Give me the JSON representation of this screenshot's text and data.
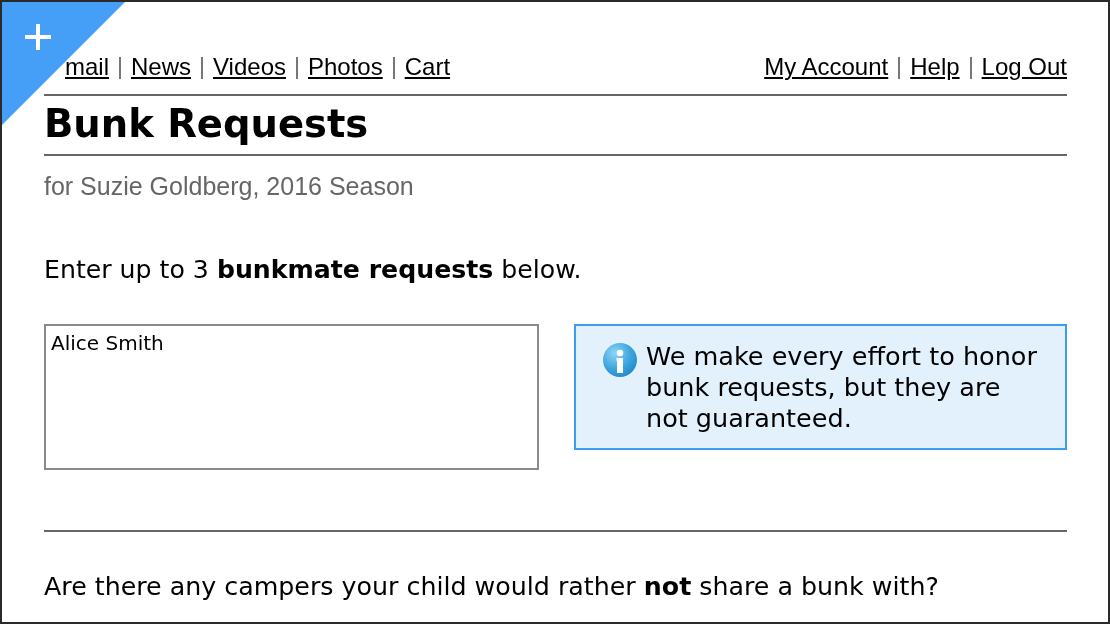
{
  "nav": {
    "left": [
      {
        "label": "mail"
      },
      {
        "label": "News"
      },
      {
        "label": "Videos"
      },
      {
        "label": "Photos"
      },
      {
        "label": "Cart"
      }
    ],
    "right": [
      {
        "label": "My Account"
      },
      {
        "label": "Help"
      },
      {
        "label": "Log Out"
      }
    ]
  },
  "page": {
    "title": "Bunk Requests",
    "subtitle": "for Suzie Goldberg, 2016 Season"
  },
  "requests": {
    "prompt": "Enter up to 3 **bunkmate requests** below.",
    "value": "Alice Smith",
    "notice": "We make every effort to honor bunk requests, but they are not guaranteed."
  },
  "avoid": {
    "question": "Are there any campers your child would rather **not** share a bunk with?"
  }
}
